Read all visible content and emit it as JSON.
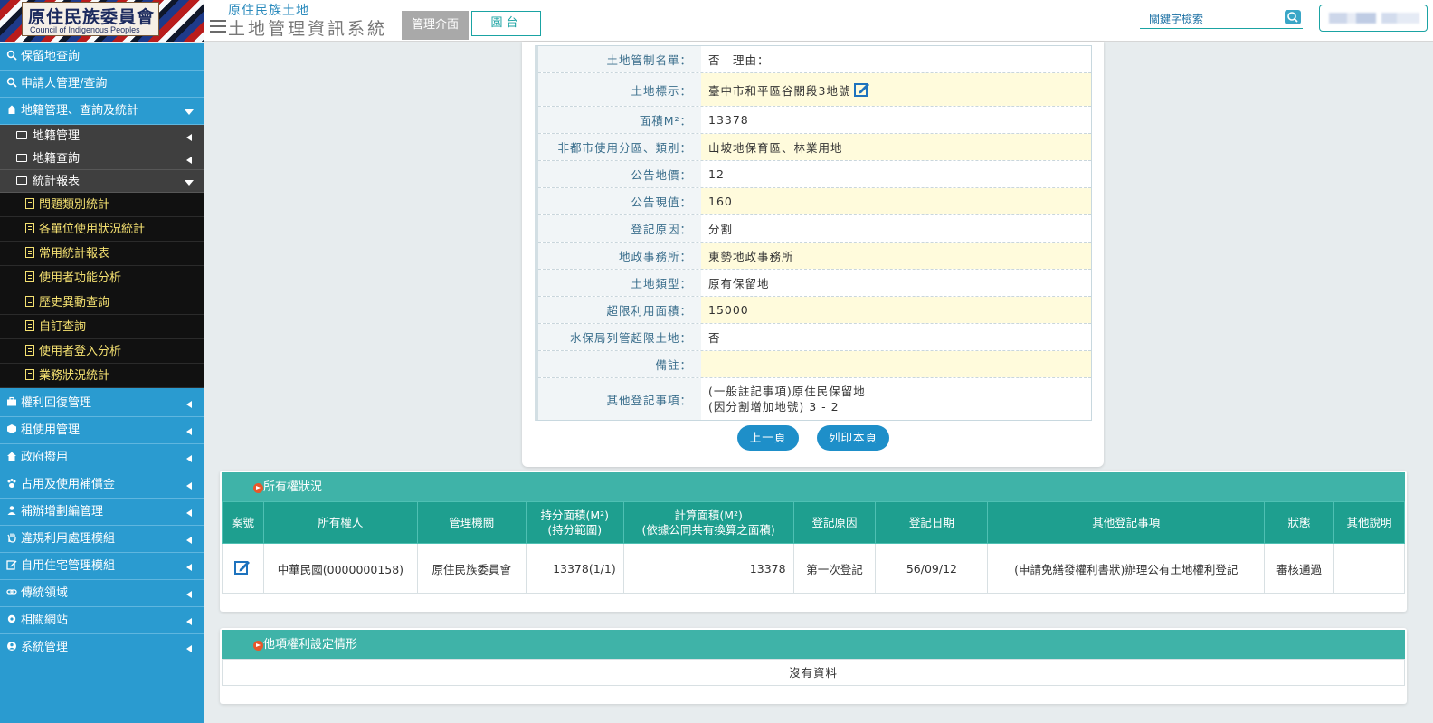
{
  "header": {
    "logo_cn": "原住民族委員會",
    "logo_en": "Council of Indigenous Peoples",
    "system_line1": "原住民族土地",
    "system_line2": "土地管理資訊系統",
    "tab_admin": "管理介面",
    "tab_front": "園台",
    "search_placeholder": "關鍵字檢索"
  },
  "sidebar": {
    "items": [
      {
        "label": "保留地查詢",
        "icon": "search-icon"
      },
      {
        "label": "申請人管理/查詢",
        "icon": "search-icon"
      },
      {
        "label": "地籍管理、查詢及統計",
        "icon": "home-icon"
      }
    ],
    "sub_items": [
      {
        "label": "地籍管理",
        "icon": "folder-icon"
      },
      {
        "label": "地籍查詢",
        "icon": "folder-icon"
      },
      {
        "label": "統計報表",
        "icon": "folder-open-icon"
      }
    ],
    "report_items": [
      "問題類別統計",
      "各單位使用狀況統計",
      "常用統計報表",
      "使用者功能分析",
      "歷史異動查詢",
      "自訂查詢",
      "使用者登入分析",
      "業務狀況統計"
    ],
    "bottom_items": [
      {
        "label": "權利回復管理",
        "icon": "briefcase-icon"
      },
      {
        "label": "租使用管理",
        "icon": "cube-icon"
      },
      {
        "label": "政府撥用",
        "icon": "home-icon"
      },
      {
        "label": "占用及使用補償金",
        "icon": "paw-icon"
      },
      {
        "label": "補辦增劃編管理",
        "icon": "user-icon"
      },
      {
        "label": "違規利用處理模組",
        "icon": "hand-icon"
      },
      {
        "label": "自用住宅管理模組",
        "icon": "edit-icon"
      },
      {
        "label": "傳統領域",
        "icon": "link-icon"
      },
      {
        "label": "相關網站",
        "icon": "gear-icon"
      },
      {
        "label": "系統管理",
        "icon": "user-circle-icon"
      }
    ]
  },
  "detail": {
    "rows": [
      {
        "label": "土地管制名單：",
        "value": "否　理由："
      },
      {
        "label": "土地標示：",
        "value": "臺中市和平區谷關段3地號"
      },
      {
        "label": "面積M²：",
        "value": "13378"
      },
      {
        "label": "非都市使用分區、類別：",
        "value": "山坡地保育區、林業用地"
      },
      {
        "label": "公告地價：",
        "value": "12"
      },
      {
        "label": "公告現值：",
        "value": "160"
      },
      {
        "label": "登記原因：",
        "value": "分割"
      },
      {
        "label": "地政事務所：",
        "value": "東勢地政事務所"
      },
      {
        "label": "土地類型：",
        "value": "原有保留地"
      },
      {
        "label": "超限利用面積：",
        "value": "15000"
      },
      {
        "label": "水保局列管超限土地：",
        "value": "否"
      },
      {
        "label": "備註：",
        "value": ""
      },
      {
        "label": "其他登記事項：",
        "value1": "(一般註記事項)原住民保留地",
        "value2": "(因分割增加地號) 3 - 2"
      }
    ],
    "btn_prev": "上一頁",
    "btn_print": "列印本頁"
  },
  "ownership": {
    "title": "所有權狀況",
    "headers": [
      "案號",
      "所有權人",
      "管理機關",
      "持分面積(M²)",
      "(持分範圍)",
      "計算面積(M²)",
      "(依據公同共有換算之面積)",
      "登記原因",
      "登記日期",
      "其他登記事項",
      "狀態",
      "其他說明"
    ],
    "row": {
      "owner": "中華民國(0000000158)",
      "agency": "原住民族委員會",
      "share_area": "13378(1/1)",
      "calc_area": "13378",
      "reason": "第一次登記",
      "date": "56/09/12",
      "other": "(申請免繕發權利書狀)辦理公有土地權利登記",
      "status": "審核通過",
      "note": ""
    }
  },
  "other_rights": {
    "title": "他項權利設定情形",
    "empty": "沒有資料"
  },
  "colors": {
    "sidebar": "#2a9bd0",
    "teal": "#3fb3a8",
    "table_head": "#1e9f8f",
    "highlight": "#fffbdc"
  }
}
